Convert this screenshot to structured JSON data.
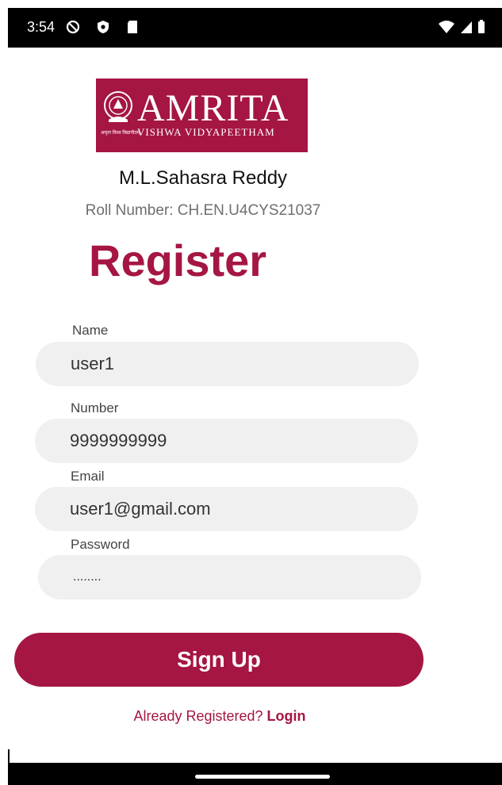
{
  "status_bar": {
    "time": "3:54",
    "icons_left": [
      "do-not-disturb-icon",
      "shield-icon",
      "sd-card-icon"
    ],
    "icons_right": [
      "wifi-icon",
      "signal-icon",
      "battery-icon"
    ]
  },
  "logo": {
    "wordmark": "AMRITA",
    "subtitle": "VISHWA VIDYAPEETHAM",
    "tagline": "अमृता विश्व विद्यापीठम्",
    "color": "#a51642"
  },
  "student": {
    "name": "M.L.Sahasra Reddy",
    "roll_number": "Roll Number: CH.EN.U4CYS21037"
  },
  "form": {
    "title": "Register",
    "fields": [
      {
        "label": "Name",
        "value": "user1"
      },
      {
        "label": "Number",
        "value": "9999999999"
      },
      {
        "label": "Email",
        "value": "user1@gmail.com"
      },
      {
        "label": "Password",
        "value": "........"
      }
    ],
    "submit_label": "Sign Up"
  },
  "footer": {
    "prompt": "Already Registered? ",
    "login_label": "Login"
  },
  "theme": {
    "accent": "#a51642",
    "field_bg": "#f0f0f0"
  }
}
